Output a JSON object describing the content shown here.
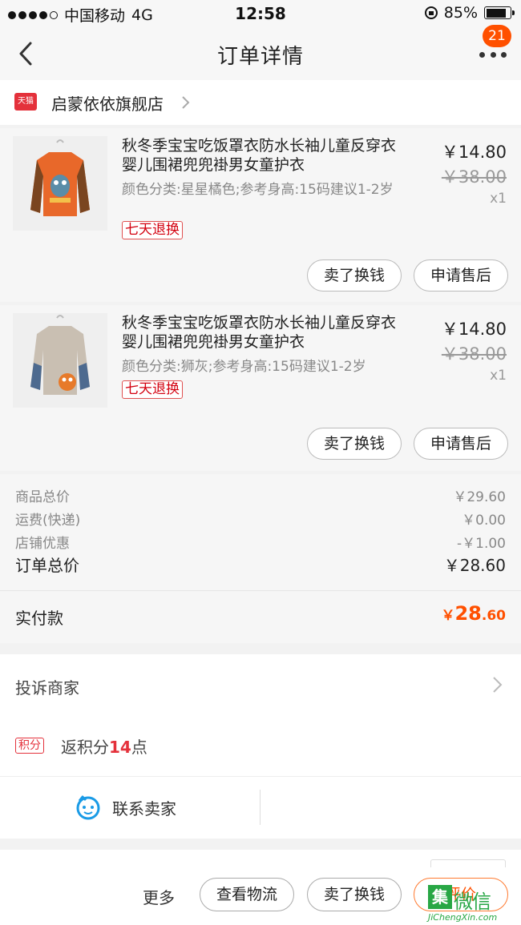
{
  "status_bar": {
    "carrier": "中国移动",
    "network": "4G",
    "time": "12:58",
    "battery": "85%"
  },
  "nav": {
    "title": "订单详情",
    "badge": "21"
  },
  "shop": {
    "badge_text": "天猫",
    "name": "启蒙依依旗舰店"
  },
  "items": [
    {
      "title": "秋冬季宝宝吃饭罩衣防水长袖儿童反穿衣婴儿围裙兜兜褂男女童护衣",
      "spec": "颜色分类:星星橘色;参考身高:15码建议1-2岁",
      "tag": "七天退换",
      "price": "￥14.80",
      "original_price": "￥38.00",
      "qty": "x1",
      "btn_sell": "卖了换钱",
      "btn_after": "申请售后"
    },
    {
      "title": "秋冬季宝宝吃饭罩衣防水长袖儿童反穿衣婴儿围裙兜兜褂男女童护衣",
      "spec": "颜色分类:狮灰;参考身高:15码建议1-2岁",
      "tag": "七天退换",
      "price": "￥14.80",
      "original_price": "￥38.00",
      "qty": "x1",
      "btn_sell": "卖了换钱",
      "btn_after": "申请售后"
    }
  ],
  "totals": {
    "goods_label": "商品总价",
    "goods_value": "￥29.60",
    "shipping_label": "运费(快递)",
    "shipping_value": "￥0.00",
    "discount_label": "店铺优惠",
    "discount_value": "-￥1.00",
    "order_total_label": "订单总价",
    "order_total_value": "￥28.60"
  },
  "payment": {
    "label": "实付款",
    "currency": "￥",
    "int": "28",
    "dec": ".60"
  },
  "complain": {
    "label": "投诉商家"
  },
  "points": {
    "tag": "积分",
    "prefix": "返积分",
    "num": "14",
    "suffix": "点"
  },
  "contact": {
    "label": "联系卖家"
  },
  "bottom": {
    "more": "更多",
    "logistics": "查看物流",
    "sell": "卖了换钱",
    "review": "评价"
  },
  "watermark": {
    "box": "集",
    "text": "微信",
    "url": "JiChengXin.com"
  },
  "colors": {
    "accent": "#ff5000",
    "tmall_red": "#e4313b"
  }
}
